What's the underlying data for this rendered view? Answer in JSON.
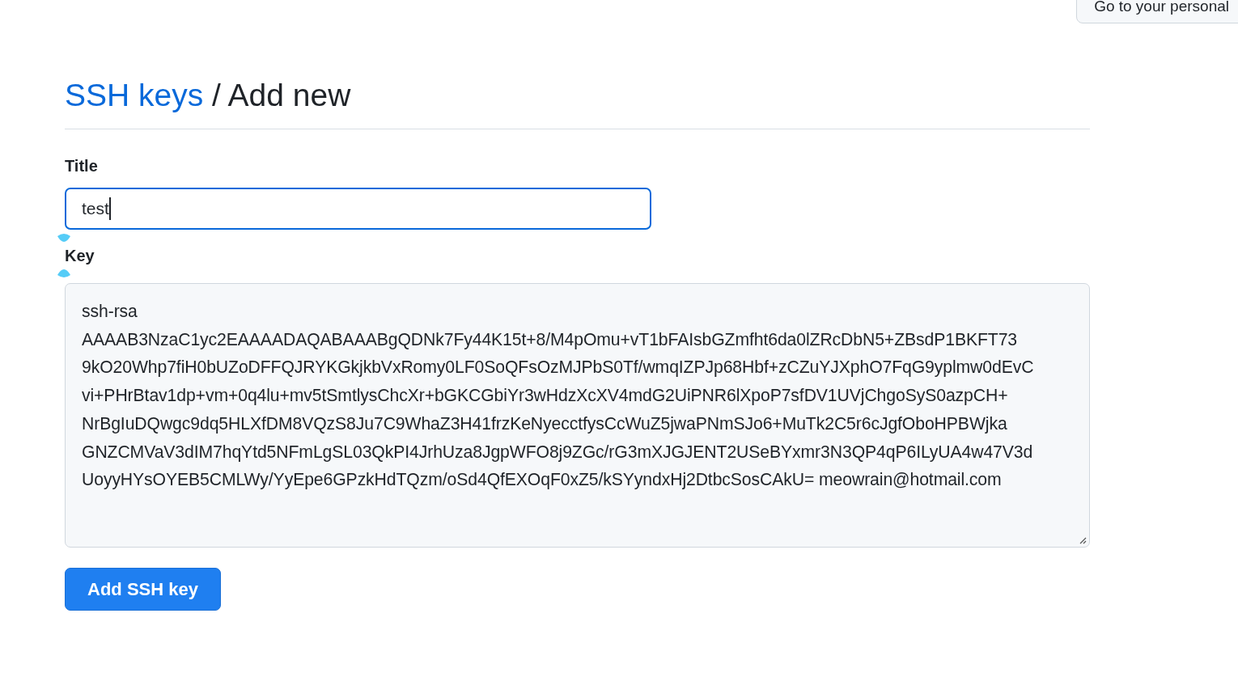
{
  "top_link": {
    "label": "Go to your personal"
  },
  "heading": {
    "link": "SSH keys",
    "separator": "/",
    "title": "Add new"
  },
  "title_field": {
    "label": "Title",
    "value": "test",
    "focused": true
  },
  "key_field": {
    "label": "Key",
    "lines": [
      "ssh-rsa",
      "AAAAB3NzaC1yc2EAAAADAQABAAABgQDNk7Fy44K15t+8/M4pOmu+vT1bFAIsbGZmfht6da0lZRcDbN5+ZBsdP1BKFT73",
      "9kO20Whp7fiH0bUZoDFFQJRYKGkjkbVxRomy0LF0SoQFsOzMJPbS0Tf/wmqIZPJp68Hbf+zCZuYJXphO7FqG9yplmw0dEvC",
      "vi+PHrBtav1dp+vm+0q4lu+mv5tSmtlysChcXr+bGKCGbiYr3wHdzXcXV4mdG2UiPNR6lXpoP7sfDV1UVjChgoSyS0azpCH+",
      "NrBgIuDQwgc9dq5HLXfDM8VQzS8Ju7C9WhaZ3H41frzKeNyecctfysCcWuZ5jwaPNmSJo6+MuTk2C5r6cJgfOboHPBWjka",
      "GNZCMVaV3dIM7hqYtd5NFmLgSL03QkPI4JrhUza8JgpWFO8j9ZGc/rG3mXJGJENT2USeBYxmr3N3QP4qP6ILyUA4w47V3d",
      "UoyyHYsOYEB5CMLWy/YyEpe6GPzkHdTQzm/oSd4QfEXOqF0xZ5/kSYyndxHj2DtbcSosCAkU= meowrain@hotmail.com"
    ]
  },
  "submit_button": {
    "label": "Add SSH key"
  }
}
